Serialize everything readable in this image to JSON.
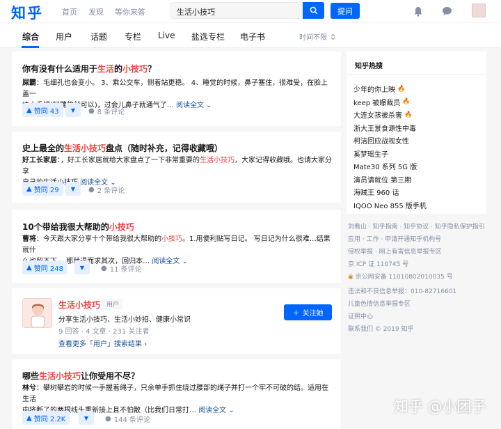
{
  "header": {
    "logo": "知乎",
    "nav": [
      "首页",
      "发现",
      "等你来答"
    ],
    "search_value": "生活小技巧",
    "ask_label": "提问"
  },
  "tabs": {
    "items": [
      "综合",
      "用户",
      "话题",
      "专栏",
      "Live",
      "盐选专栏",
      "电子书"
    ],
    "active": "综合",
    "time_filter": "时间不限"
  },
  "results": [
    {
      "title_pre": "你有没有什么适用于",
      "title_hl": "生活",
      "title_mid": "的",
      "title_hl2": "小技巧",
      "title_post": "？",
      "author": "屎霸",
      "excerpt_line1": "：毛细孔也会变小。 3、乘公交车，侧着站更稳。 4、睡觉的时候，鼻子塞住，很难受，在脸上盖一",
      "excerpt_line2": "块小手绢(轻薄的就可以)，过会儿鼻子就通气了…",
      "readmore": "阅读全文",
      "votes": "赞同 43",
      "comments": "8 条评论"
    },
    {
      "title_pre": "史上最全的",
      "title_hl": "生活小技巧",
      "title_post": "盘点（随时补充，记得收藏哦）",
      "author": "好工长家居",
      "excerpt_line1_a": "：，好工长家居就给大家盘点了一下非常重要的",
      "excerpt_line1_hl": "生活小技巧",
      "excerpt_line1_b": "，大家记得收藏哦。也请大家分享",
      "excerpt_line2": "自己的生活小技巧",
      "readmore": "阅读全文",
      "votes": "赞同 29",
      "comments": "2 条评论"
    },
    {
      "title_pre": "10个带给我很大帮助的",
      "title_hl": "小技巧",
      "author": "曹将",
      "excerpt_line1_a": "：今天跟大家分享十个带给我很大帮助的",
      "excerpt_line1_hl": "小技巧",
      "excerpt_line1_b": "。1.用便利贴写日记。 写日记为什么很难…结果就什",
      "excerpt_line2": "么也留不下。 那就退而求其次，回归本…",
      "readmore": "阅读全文",
      "votes": "赞同 248",
      "comments": "11 条评论"
    },
    {
      "title_pre": "哪些",
      "title_hl": "生活小技巧",
      "title_post": "让你受用不尽？",
      "author": "林兮",
      "excerpt_line1": "：攀树攀岩的时候一手握着绳子，只余单手抓住绕过腰部的绳子并打一个牢不可破的结。适用在生活",
      "excerpt_line2": "中将断了的两根线头重新接上且不怕散（比我们日常打…",
      "readmore": "阅读全文",
      "votes": "赞同 2.2K",
      "comments": "144 条评论"
    }
  ],
  "user_card": {
    "name": "生活小技巧",
    "tag": "用户",
    "desc": "分享生活小技巧、生活小妙招、健康小常识",
    "stats": "9 回答 · 4 文章 · 231 关注者",
    "more": "查看更多「用户」搜索结果",
    "follow": "关注她"
  },
  "sidebar": {
    "title": "知乎热搜",
    "hot": [
      {
        "text": "少年的你上映",
        "hot": true
      },
      {
        "text": "keep 被曝裁员",
        "hot": true
      },
      {
        "text": "大连女孩被杀害",
        "hot": true
      },
      {
        "text": "浙大王景食源性中毒",
        "hot": false
      },
      {
        "text": "柯洁回应战视女性",
        "hot": false
      },
      {
        "text": "奚梦瑶生子",
        "hot": false
      },
      {
        "text": "Mate30 系列 5G 版",
        "hot": false
      },
      {
        "text": "演员请就位 第三期",
        "hot": false
      },
      {
        "text": "海贼王 960 话",
        "hot": false
      },
      {
        "text": "IQOO Neo 855 版手机",
        "hot": false
      }
    ],
    "footer": [
      "刘看山 · 知乎指南 · 知乎协议 · 知乎隐私保护指引",
      "应用 · 工作 · 申请开通知乎机构号",
      "侵权举报 · 网上有害信息举报专区",
      "京 ICP 证 110745 号",
      "京公网安备 11010802010035 号",
      "违法和不良信息举报：010-82716601",
      "儿童色情信息举报专区",
      "证照中心",
      "联系我们 © 2019 知乎"
    ]
  },
  "watermark": "知乎 @小团子",
  "colors": {
    "brand": "#0066ff",
    "highlight": "#f1403c",
    "link": "#175199",
    "muted": "#8590a6"
  }
}
